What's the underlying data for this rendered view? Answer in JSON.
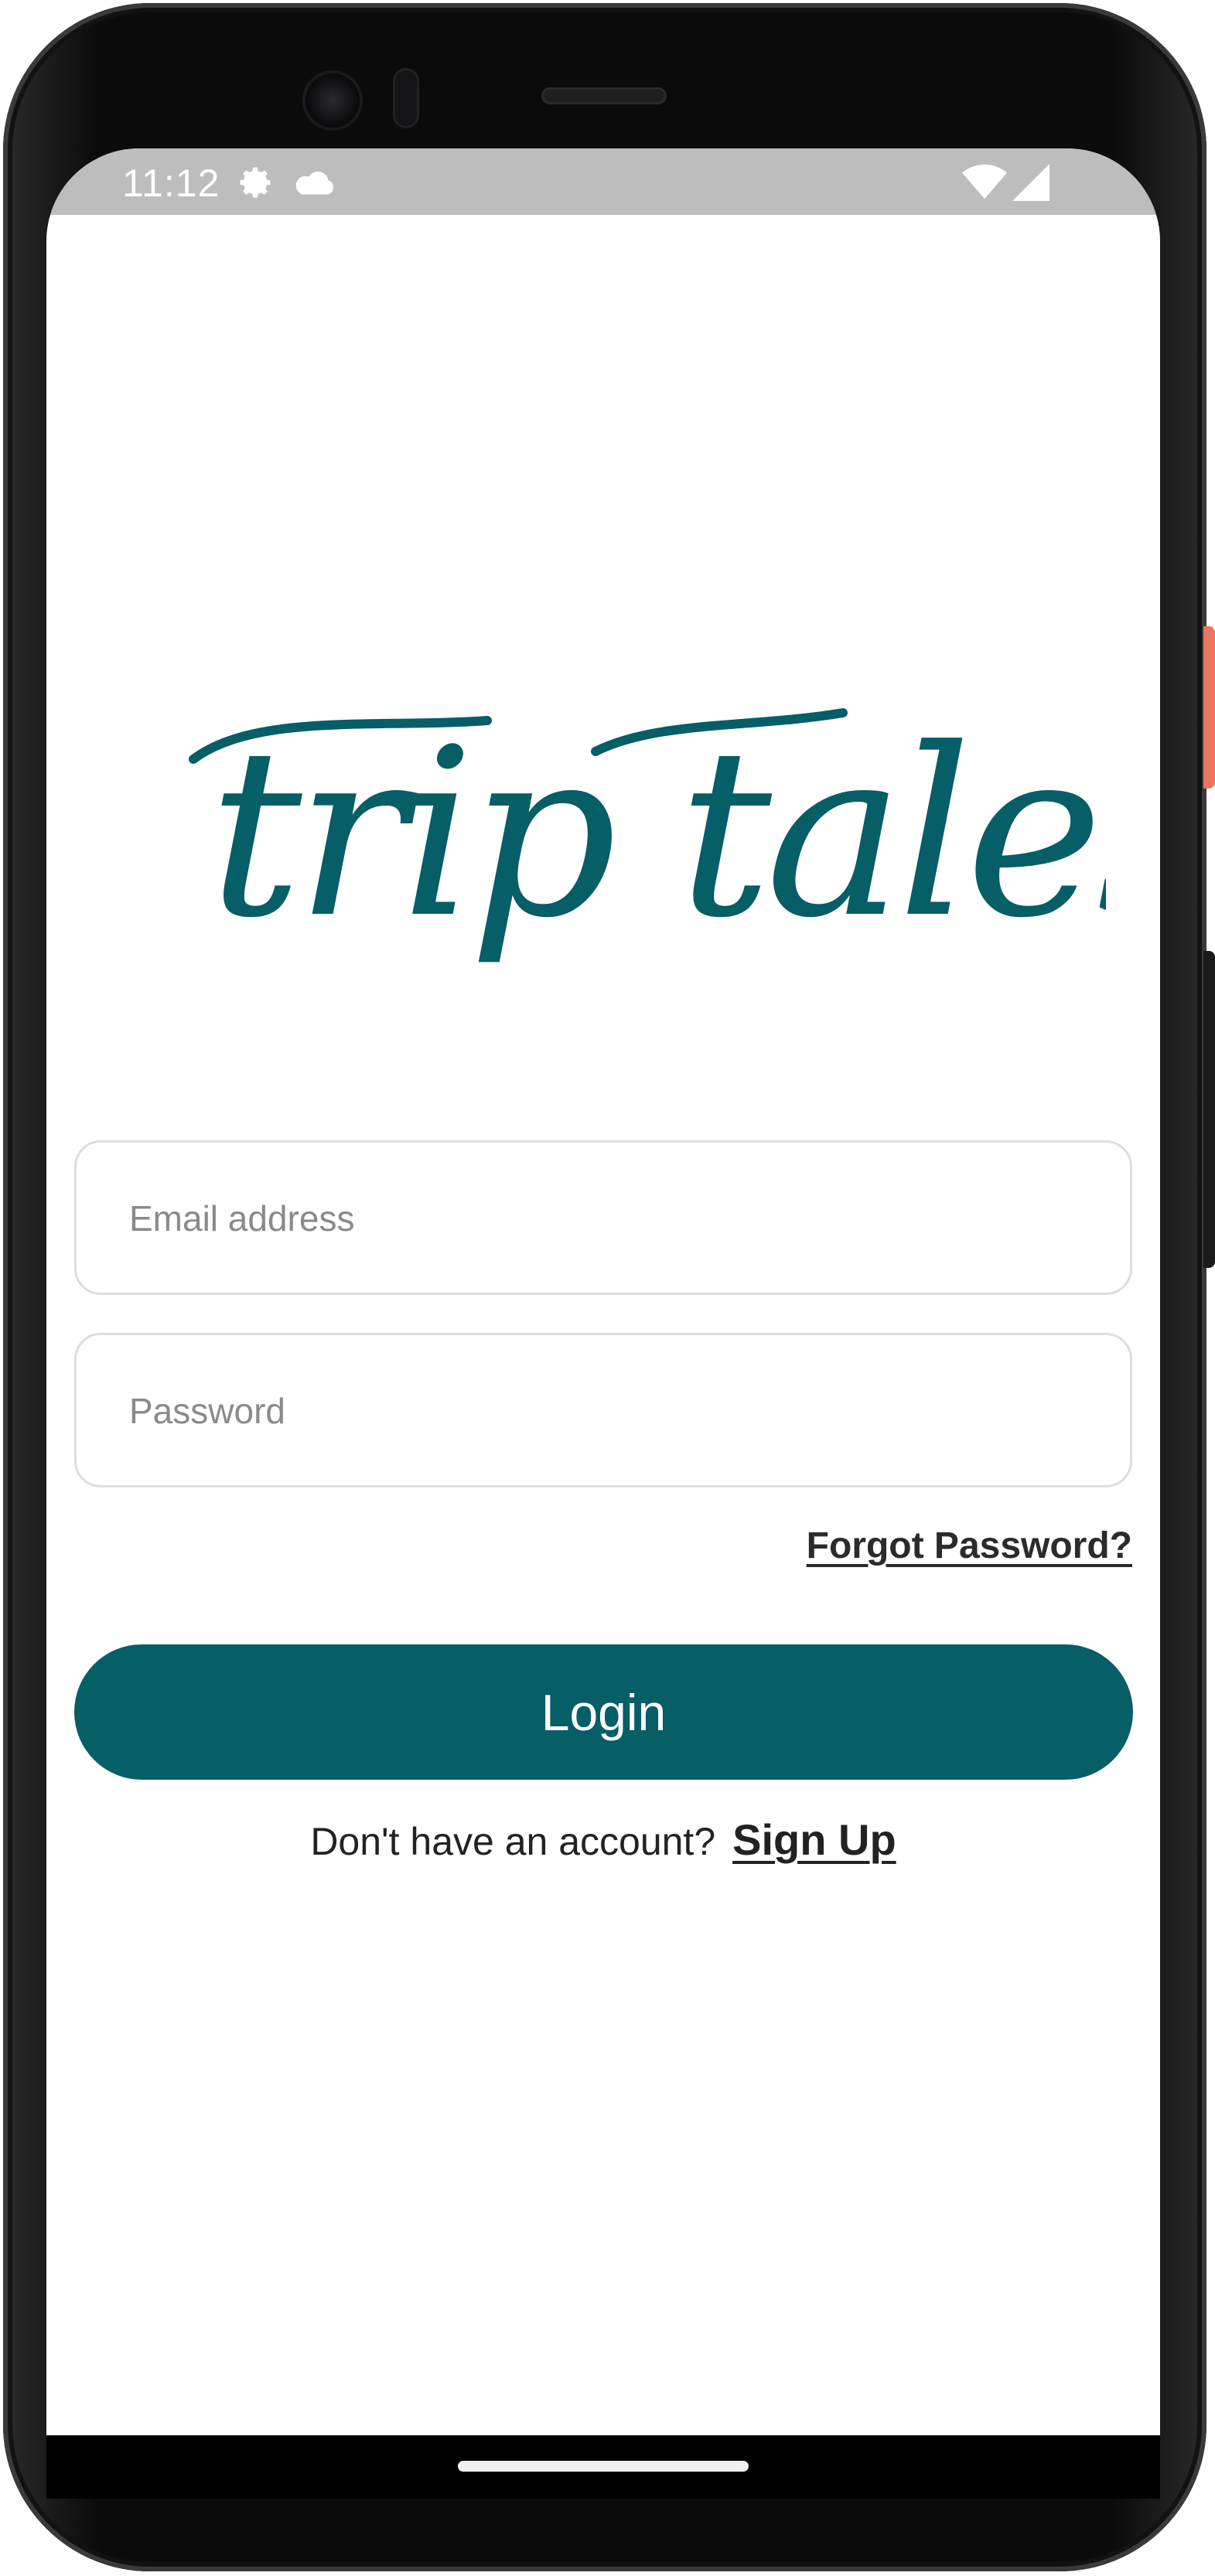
{
  "status_bar": {
    "time": "11:12",
    "icons": [
      "gear-icon",
      "cloud-icon",
      "wifi-icon",
      "signal-icon"
    ]
  },
  "brand": {
    "logo_text": "trip tales",
    "accent_color": "#065e66"
  },
  "form": {
    "email_placeholder": "Email address",
    "email_value": "",
    "password_placeholder": "Password",
    "password_value": "",
    "forgot_password_label": "Forgot Password?",
    "login_label": "Login"
  },
  "signup": {
    "prompt": "Don't have an account?",
    "link_label": "Sign Up"
  }
}
